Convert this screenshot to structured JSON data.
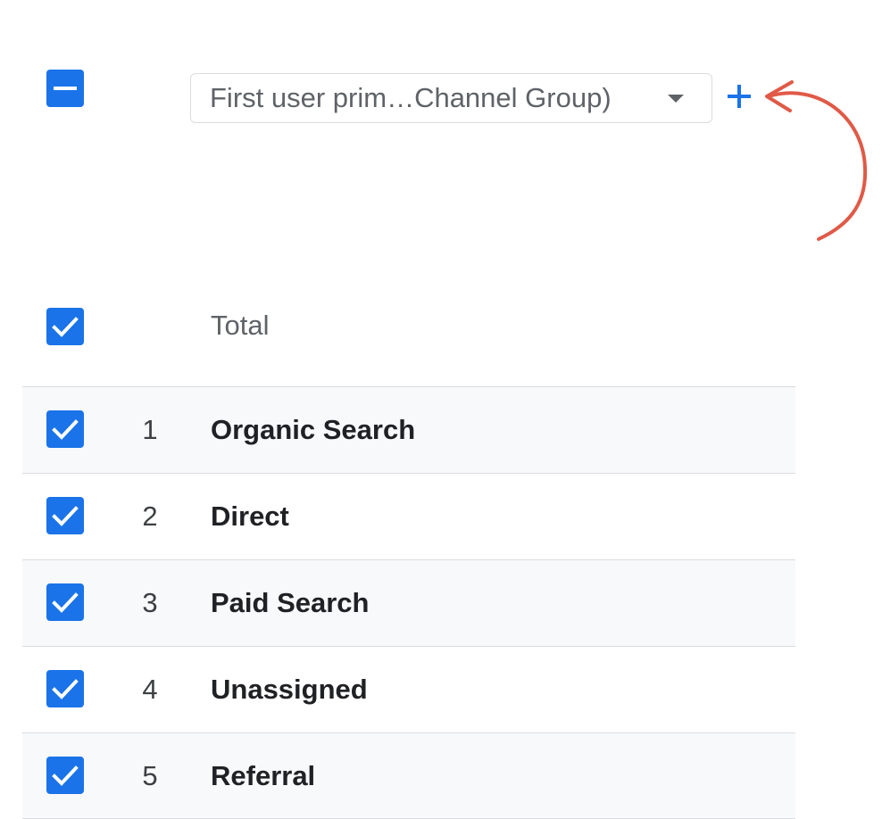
{
  "header": {
    "select_all_state": "indeterminate",
    "dimension_select": {
      "label": "First user prim…Channel Group)",
      "icon": "dropdown-caret-icon"
    },
    "add_dimension_icon": "plus-icon"
  },
  "total": {
    "checked": true,
    "label": "Total"
  },
  "rows": [
    {
      "index": "1",
      "label": "Organic Search",
      "checked": true
    },
    {
      "index": "2",
      "label": "Direct",
      "checked": true
    },
    {
      "index": "3",
      "label": "Paid Search",
      "checked": true
    },
    {
      "index": "4",
      "label": "Unassigned",
      "checked": true
    },
    {
      "index": "5",
      "label": "Referral",
      "checked": true
    }
  ],
  "colors": {
    "checkbox": "#1a73e8",
    "add_button": "#1a73e8",
    "annotation_arrow": "#e05a47",
    "row_alt_background": "#f8f9fa",
    "divider": "#dadce0"
  }
}
